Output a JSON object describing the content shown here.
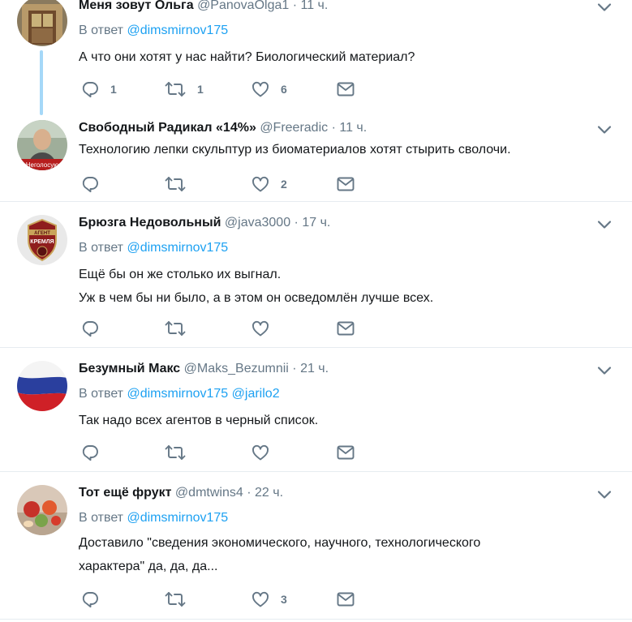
{
  "tweets": [
    {
      "name": "Меня зовут Ольга",
      "handle": "@PanovaOlga1",
      "dot": "·",
      "time": "11 ч.",
      "reply_prefix": "В ответ",
      "mentions": [
        "@dimsmirnov175"
      ],
      "lines": [
        "А что они хотят у нас найти? Биологический материал?"
      ],
      "counts": {
        "reply": "1",
        "retweet": "1",
        "like": "6"
      }
    },
    {
      "name": "Свободный Радикал «14%»",
      "handle": "@Freeradic",
      "dot": "·",
      "time": "11 ч.",
      "lines": [
        "Технологию лепки скульптур из биоматериалов хотят стырить сволочи."
      ],
      "avatar_caption": "Неголосую",
      "counts": {
        "reply": "",
        "retweet": "",
        "like": "2"
      }
    },
    {
      "name": "Брюзга Недовольный",
      "handle": "@java3000",
      "dot": "·",
      "time": "17 ч.",
      "reply_prefix": "В ответ",
      "mentions": [
        "@dimsmirnov175"
      ],
      "lines": [
        "Ещё бы он же столько их выгнал.",
        "Уж в чем бы ни было, а в этом он осведомлён лучше всех."
      ],
      "avatar_caption": [
        "АГЕНТ",
        "КРЕМЛЯ"
      ],
      "counts": {
        "reply": "",
        "retweet": "",
        "like": ""
      }
    },
    {
      "name": "Безумный Макс",
      "handle": "@Maks_Bezumnii",
      "dot": "·",
      "time": "21 ч.",
      "reply_prefix": "В ответ",
      "mentions": [
        "@dimsmirnov175",
        "@jarilo2"
      ],
      "lines": [
        "Так надо всех агентов в черный список."
      ],
      "counts": {
        "reply": "",
        "retweet": "",
        "like": ""
      }
    },
    {
      "name": "Тот ещё фрукт",
      "handle": "@dmtwins4",
      "dot": "·",
      "time": "22 ч.",
      "reply_prefix": "В ответ",
      "mentions": [
        "@dimsmirnov175"
      ],
      "lines": [
        "Доставило \"сведения экономического, научного, технологического",
        "характера\" да, да, да..."
      ],
      "counts": {
        "reply": "",
        "retweet": "",
        "like": "3"
      }
    }
  ],
  "colors": {
    "accent": "#1da1f2",
    "muted": "#657786",
    "text": "#14171a",
    "thread": "#a5d8f8",
    "divider": "#e6ecf0"
  },
  "icons": {
    "reply": "reply-icon",
    "retweet": "retweet-icon",
    "like": "like-icon",
    "dm": "message-icon",
    "caret": "chevron-down-icon"
  }
}
